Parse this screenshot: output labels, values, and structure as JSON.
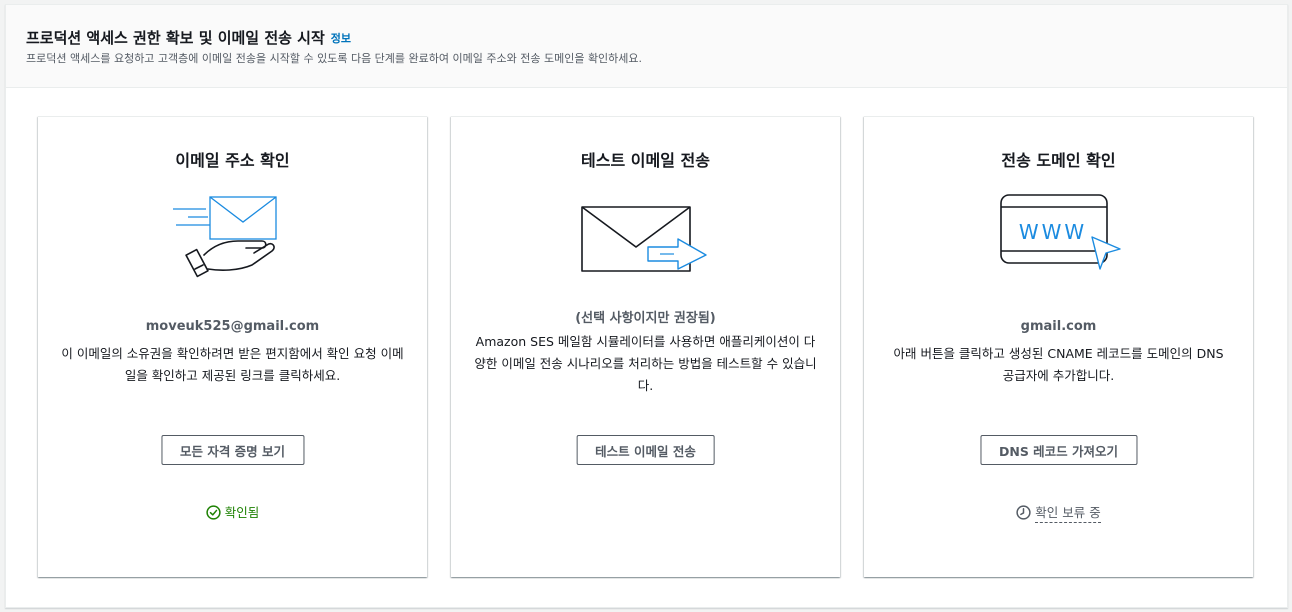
{
  "header": {
    "title": "프로덕션 액세스 권한 확보 및 이메일 전송 시작",
    "info_link": "정보",
    "description": "프로덕션 액세스를 요청하고 고객층에 이메일 전송을 시작할 수 있도록 다음 단계를 완료하여 이메일 주소와 전송 도메인을 확인하세요."
  },
  "cards": [
    {
      "title": "이메일 주소 확인",
      "subtitle": "moveuk525@gmail.com",
      "body": "이 이메일의 소유권을 확인하려면 받은 편지함에서 확인 요청 이메일을 확인하고 제공된 링크를 클릭하세요.",
      "button": "모든 자격 증명 보기",
      "status": "확인됨",
      "illustration": "hand-envelope-icon"
    },
    {
      "title": "테스트 이메일 전송",
      "subtitle": "(선택 사항이지만 권장됨)",
      "body": "Amazon SES 메일함 시뮬레이터를 사용하면 애플리케이션이 다양한 이메일 전송 시나리오를 처리하는 방법을 테스트할 수 있습니다.",
      "button": "테스트 이메일 전송",
      "illustration": "envelope-arrow-icon"
    },
    {
      "title": "전송 도메인 확인",
      "subtitle": "gmail.com",
      "body": "아래 버튼을 클릭하고 생성된 CNAME 레코드를 도메인의 DNS 공급자에 추가합니다.",
      "button": "DNS 레코드 가져오기",
      "status": "확인 보류 중",
      "illustration": "browser-cursor-icon",
      "www_text": "WWW"
    }
  ],
  "colors": {
    "accent_blue": "#0073bb",
    "success_green": "#1d8102",
    "text_secondary": "#545b64"
  }
}
